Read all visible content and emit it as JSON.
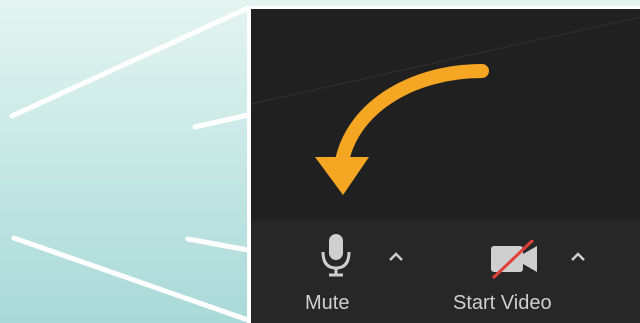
{
  "toolbar": {
    "mute": {
      "label": "Mute",
      "icon": "microphone-icon"
    },
    "start_video": {
      "label": "Start Video",
      "icon": "video-camera-off-icon"
    },
    "caret_icon": "chevron-up-icon"
  },
  "callout": {
    "icon": "curved-arrow-icon",
    "color": "#f5a623"
  },
  "colors": {
    "panel_background": "#202020",
    "toolbar_background": "#272727",
    "text": "#cfcfcf",
    "video_slash": "#e0403a",
    "zoom_lines": "#ffffff"
  }
}
